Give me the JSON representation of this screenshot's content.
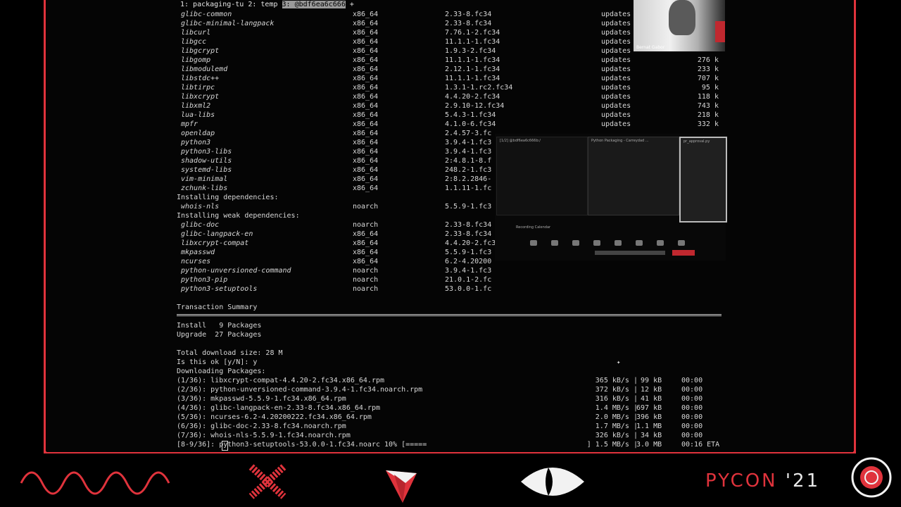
{
  "tabs": {
    "t1": "1: packaging-tu",
    "t2": "2: temp",
    "t3": "3: @bdf6ea6c666",
    "plus": "+"
  },
  "packages": [
    {
      "n": "glibc-common",
      "a": "x86_64",
      "v": "2.33-8.fc34",
      "r": "updates",
      "s": ""
    },
    {
      "n": "glibc-minimal-langpack",
      "a": "x86_64",
      "v": "2.33-8.fc34",
      "r": "updates",
      "s": ""
    },
    {
      "n": "libcurl",
      "a": "x86_64",
      "v": "7.76.1-2.fc34",
      "r": "updates",
      "s": ""
    },
    {
      "n": "libgcc",
      "a": "x86_64",
      "v": "11.1.1-1.fc34",
      "r": "updates",
      "s": ""
    },
    {
      "n": "libgcrypt",
      "a": "x86_64",
      "v": "1.9.3-2.fc34",
      "r": "updates",
      "s": ""
    },
    {
      "n": "libgomp",
      "a": "x86_64",
      "v": "11.1.1-1.fc34",
      "r": "updates",
      "s": "276 k"
    },
    {
      "n": "libmodulemd",
      "a": "x86_64",
      "v": "2.12.1-1.fc34",
      "r": "updates",
      "s": "233 k"
    },
    {
      "n": "libstdc++",
      "a": "x86_64",
      "v": "11.1.1-1.fc34",
      "r": "updates",
      "s": "707 k"
    },
    {
      "n": "libtirpc",
      "a": "x86_64",
      "v": "1.3.1-1.rc2.fc34",
      "r": "updates",
      "s": "95 k"
    },
    {
      "n": "libxcrypt",
      "a": "x86_64",
      "v": "4.4.20-2.fc34",
      "r": "updates",
      "s": "118 k"
    },
    {
      "n": "libxml2",
      "a": "x86_64",
      "v": "2.9.10-12.fc34",
      "r": "updates",
      "s": "743 k"
    },
    {
      "n": "lua-libs",
      "a": "x86_64",
      "v": "5.4.3-1.fc34",
      "r": "updates",
      "s": "218 k"
    },
    {
      "n": "mpfr",
      "a": "x86_64",
      "v": "4.1.0-6.fc34",
      "r": "updates",
      "s": "332 k"
    },
    {
      "n": "openldap",
      "a": "x86_64",
      "v": "2.4.57-3.fc",
      "r": "",
      "s": ""
    },
    {
      "n": "python3",
      "a": "x86_64",
      "v": "3.9.4-1.fc3",
      "r": "",
      "s": ""
    },
    {
      "n": "python3-libs",
      "a": "x86_64",
      "v": "3.9.4-1.fc3",
      "r": "",
      "s": ""
    },
    {
      "n": "shadow-utils",
      "a": "x86_64",
      "v": "2:4.8.1-8.f",
      "r": "",
      "s": ""
    },
    {
      "n": "systemd-libs",
      "a": "x86_64",
      "v": "248.2-1.fc3",
      "r": "",
      "s": ""
    },
    {
      "n": "vim-minimal",
      "a": "x86_64",
      "v": "2:8.2.2846-",
      "r": "",
      "s": ""
    },
    {
      "n": "zchunk-libs",
      "a": "x86_64",
      "v": "1.1.11-1.fc",
      "r": "",
      "s": ""
    }
  ],
  "installing_deps": "Installing dependencies:",
  "deps": [
    {
      "n": "whois-nls",
      "a": "noarch",
      "v": "5.5.9-1.fc3"
    }
  ],
  "installing_weak": "Installing weak dependencies:",
  "weak": [
    {
      "n": "glibc-doc",
      "a": "noarch",
      "v": "2.33-8.fc34"
    },
    {
      "n": "glibc-langpack-en",
      "a": "x86_64",
      "v": "2.33-8.fc34"
    },
    {
      "n": "libxcrypt-compat",
      "a": "x86_64",
      "v": "4.4.20-2.fc34"
    },
    {
      "n": "mkpasswd",
      "a": "x86_64",
      "v": "5.5.9-1.fc3"
    },
    {
      "n": "ncurses",
      "a": "x86_64",
      "v": "6.2-4.20200"
    },
    {
      "n": "python-unversioned-command",
      "a": "noarch",
      "v": "3.9.4-1.fc3"
    },
    {
      "n": "python3-pip",
      "a": "noarch",
      "v": "21.0.1-2.fc"
    },
    {
      "n": "python3-setuptools",
      "a": "noarch",
      "v": "53.0.0-1.fc"
    }
  ],
  "summary": {
    "title": "Transaction Summary",
    "install": "Install   9 Packages",
    "upgrade": "Upgrade  27 Packages",
    "total": "Total download size: 28 M",
    "prompt": "Is this ok [y/N]: y",
    "downloading": "Downloading Packages:"
  },
  "downloads": [
    {
      "f": "(1/36): libxcrypt-compat-4.4.20-2.fc34.x86_64.rpm",
      "sp": "365 kB/s |",
      "sz": " 99 kB",
      "t": "00:00"
    },
    {
      "f": "(2/36): python-unversioned-command-3.9.4-1.fc34.noarch.rpm",
      "sp": "372 kB/s |",
      "sz": " 12 kB",
      "t": "00:00"
    },
    {
      "f": "(3/36): mkpasswd-5.5.9-1.fc34.x86_64.rpm",
      "sp": "316 kB/s |",
      "sz": " 41 kB",
      "t": "00:00"
    },
    {
      "f": "(4/36): glibc-langpack-en-2.33-8.fc34.x86_64.rpm",
      "sp": "1.4 MB/s |",
      "sz": "697 kB",
      "t": "00:00"
    },
    {
      "f": "(5/36): ncurses-6.2-4.20200222.fc34.x86_64.rpm",
      "sp": "2.0 MB/s |",
      "sz": "396 kB",
      "t": "00:00"
    },
    {
      "f": "(6/36): glibc-doc-2.33-8.fc34.noarch.rpm",
      "sp": "1.7 MB/s |",
      "sz": "1.1 MB",
      "t": "00:00"
    },
    {
      "f": "(7/36): whois-nls-5.5.9-1.fc34.noarch.rpm",
      "sp": "326 kB/s |",
      "sz": " 34 kB",
      "t": "00:00"
    }
  ],
  "progress": {
    "f": "[8-9/36]: python3-setuptools-53.0.0-1.fc34.noarc 10% [=====",
    "sp": "] 1.5 MB/s |",
    "sz": "3.0 MB",
    "t": "00:16 ETA"
  },
  "webcam": {
    "caption": "Bernat Gabor"
  },
  "zoom": {
    "t1": "[1/2] @bdf6ea6c666b:/",
    "t2": "Python Packaging - Carreydad ...",
    "t3": "pr_approval.py",
    "rec": "Recording Calendar"
  },
  "pycon": {
    "word": "PYCON",
    "year": "'21"
  },
  "colors": {
    "accent": "#e0333c",
    "text": "#d8d8d8"
  }
}
